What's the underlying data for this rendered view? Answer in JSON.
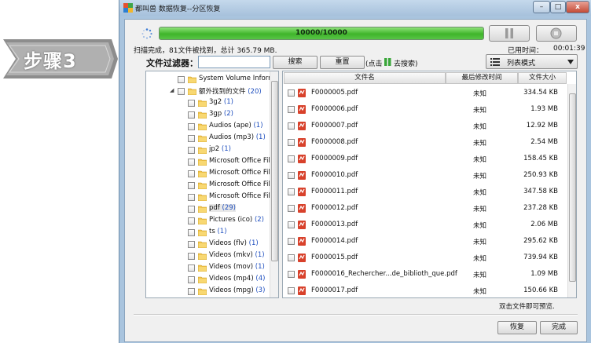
{
  "step_badge": {
    "label": "步骤3"
  },
  "window": {
    "title": "都叫兽 数据恢复--分区恢复",
    "controls": {
      "minimize": "–",
      "maximize": "□",
      "close": "x"
    }
  },
  "progress": {
    "label": "10000/10000",
    "fraction": 1.0,
    "color": "#3fb52a"
  },
  "scan_status": "扫描完成，81文件被找到，总计 365.79 MB.",
  "elapsed": {
    "label": "已用时间：",
    "value": "00:01:39"
  },
  "filter": {
    "label": "文件过滤器：",
    "input_value": "",
    "search_label": "搜索",
    "reset_label": "重置",
    "hint_prefix": "(点击",
    "hint_suffix": "去搜索)"
  },
  "view_mode": {
    "label": "列表模式"
  },
  "tree": {
    "items": [
      {
        "label": "System Volume Informat",
        "count": "",
        "level": 1
      },
      {
        "label": "额外找到的文件",
        "count": "(20)",
        "level": 1,
        "expanded": true
      },
      {
        "label": "3g2",
        "count": "(1)",
        "level": 2
      },
      {
        "label": "3gp",
        "count": "(2)",
        "level": 2
      },
      {
        "label": "Audios (ape)",
        "count": "(1)",
        "level": 2
      },
      {
        "label": "Audios (mp3)",
        "count": "(1)",
        "level": 2
      },
      {
        "label": "jp2",
        "count": "(1)",
        "level": 2
      },
      {
        "label": "Microsoft Office Files",
        "count": "",
        "level": 2
      },
      {
        "label": "Microsoft Office Files",
        "count": "",
        "level": 2
      },
      {
        "label": "Microsoft Office Files",
        "count": "",
        "level": 2
      },
      {
        "label": "Microsoft Office Files",
        "count": "",
        "level": 2
      },
      {
        "label": "pdf",
        "count": "(29)",
        "level": 2,
        "selected": true
      },
      {
        "label": "Pictures (ico)",
        "count": "(2)",
        "level": 2
      },
      {
        "label": "ts",
        "count": "(1)",
        "level": 2
      },
      {
        "label": "Videos (flv)",
        "count": "(1)",
        "level": 2
      },
      {
        "label": "Videos (mkv)",
        "count": "(1)",
        "level": 2
      },
      {
        "label": "Videos (mov)",
        "count": "(1)",
        "level": 2
      },
      {
        "label": "Videos (mp4)",
        "count": "(4)",
        "level": 2
      },
      {
        "label": "Videos (mpg)",
        "count": "(3)",
        "level": 2
      }
    ]
  },
  "file_list": {
    "headers": {
      "name": "文件名",
      "modified": "最后修改时间",
      "size": "文件大小"
    },
    "rows": [
      {
        "name": "F0000005.pdf",
        "modified": "未知",
        "size": "334.54 KB"
      },
      {
        "name": "F0000006.pdf",
        "modified": "未知",
        "size": "1.93 MB"
      },
      {
        "name": "F0000007.pdf",
        "modified": "未知",
        "size": "12.92 MB"
      },
      {
        "name": "F0000008.pdf",
        "modified": "未知",
        "size": "2.54 MB"
      },
      {
        "name": "F0000009.pdf",
        "modified": "未知",
        "size": "158.45 KB"
      },
      {
        "name": "F0000010.pdf",
        "modified": "未知",
        "size": "250.93 KB"
      },
      {
        "name": "F0000011.pdf",
        "modified": "未知",
        "size": "347.58 KB"
      },
      {
        "name": "F0000012.pdf",
        "modified": "未知",
        "size": "237.28 KB"
      },
      {
        "name": "F0000013.pdf",
        "modified": "未知",
        "size": "2.06 MB"
      },
      {
        "name": "F0000014.pdf",
        "modified": "未知",
        "size": "295.62 KB"
      },
      {
        "name": "F0000015.pdf",
        "modified": "未知",
        "size": "739.94 KB"
      },
      {
        "name": "F0000016_Rechercher...de_biblioth_que.pdf",
        "modified": "未知",
        "size": "1.09 MB"
      },
      {
        "name": "F0000017.pdf",
        "modified": "未知",
        "size": "150.66 KB"
      }
    ]
  },
  "preview_hint": "双击文件即可预览.",
  "actions": {
    "recover_label": "恢复",
    "finish_label": "完成"
  }
}
